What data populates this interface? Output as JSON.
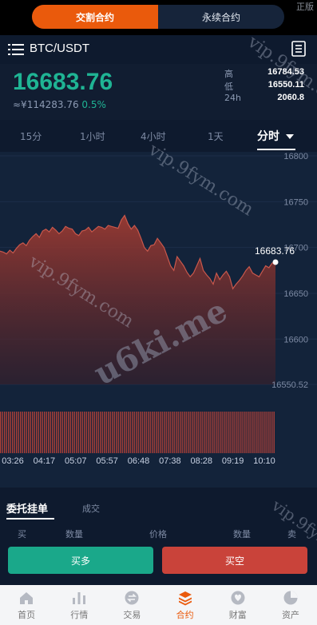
{
  "topbar": {
    "segments": [
      "交割合约",
      "永续合约"
    ],
    "corner_tag": "正版"
  },
  "header": {
    "pair": "BTC/USDT"
  },
  "ticker": {
    "last_price": "16683.76",
    "cny_price": "≈¥114283.76",
    "change_pct": "0.5%",
    "stats": [
      {
        "label": "高",
        "value": "16784.53"
      },
      {
        "label": "低",
        "value": "16550.11"
      },
      {
        "label": "24h",
        "value": "2060.8"
      }
    ]
  },
  "timeframes": [
    "15分",
    "1小时",
    "4小时",
    "1天",
    "分时"
  ],
  "chart_data": {
    "type": "area",
    "current_price_label": "16683.76",
    "y_ticks": [
      "16800",
      "16750",
      "16700",
      "16650",
      "16600",
      "16550.52"
    ],
    "x_ticks": [
      "03:26",
      "04:17",
      "05:07",
      "05:57",
      "06:48",
      "07:38",
      "08:28",
      "09:19",
      "10:10"
    ],
    "ylim": [
      16550.52,
      16800
    ],
    "values": [
      16696,
      16695,
      16693,
      16697,
      16694,
      16699,
      16703,
      16705,
      16702,
      16708,
      16712,
      16715,
      16711,
      16718,
      16720,
      16717,
      16722,
      16719,
      16715,
      16718,
      16723,
      16721,
      16720,
      16715,
      16713,
      16718,
      16719,
      16722,
      16717,
      16720,
      16723,
      16722,
      16720,
      16724,
      16723,
      16722,
      16721,
      16730,
      16735,
      16726,
      16720,
      16724,
      16719,
      16710,
      16700,
      16696,
      16702,
      16703,
      16710,
      16705,
      16700,
      16690,
      16680,
      16675,
      16690,
      16685,
      16680,
      16673,
      16668,
      16672,
      16680,
      16688,
      16675,
      16670,
      16666,
      16660,
      16672,
      16665,
      16670,
      16674,
      16668,
      16655,
      16660,
      16664,
      16669,
      16675,
      16679,
      16672,
      16670,
      16668,
      16674,
      16680,
      16678,
      16683,
      16684
    ]
  },
  "orders": {
    "tabs": [
      "委托挂单",
      "成交"
    ],
    "columns": [
      "买",
      "数量",
      "价格",
      "数量",
      "卖"
    ]
  },
  "actions": {
    "buy_label": "买多",
    "sell_label": "买空"
  },
  "nav": {
    "items": [
      "首页",
      "行情",
      "交易",
      "合约",
      "财富",
      "资产"
    ],
    "active": "合约"
  },
  "watermarks": [
    "vip.9fym.com",
    "u6ki.me",
    "vip.9fym.com",
    "vip.9fym.com",
    "vip.9fym.com"
  ],
  "colors": {
    "accent": "#ea5a0c",
    "up": "#1fb494",
    "down": "#c9433a"
  }
}
